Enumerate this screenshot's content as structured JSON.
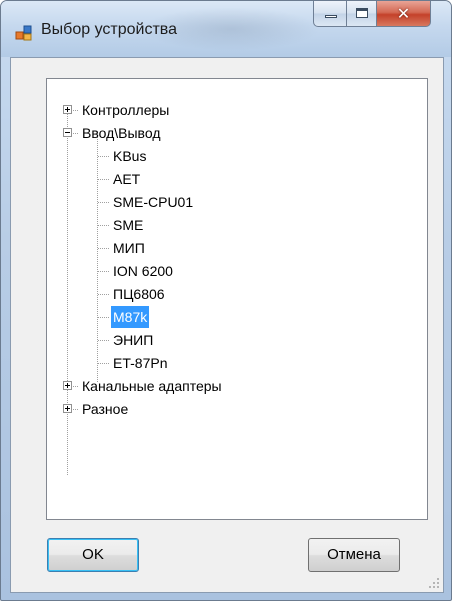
{
  "window": {
    "title": "Выбор устройства"
  },
  "tree": {
    "nodes": [
      {
        "label": "Контроллеры",
        "expanded": false
      },
      {
        "label": "Ввод\\Вывод",
        "expanded": true,
        "children": [
          "KBus",
          "AET",
          "SME-CPU01",
          "SME",
          "МИП",
          "ION 6200",
          "ПЦ6806",
          "M87k",
          "ЭНИП",
          "ET-87Pn"
        ],
        "selected_child": "M87k"
      },
      {
        "label": "Канальные адаптеры",
        "expanded": false
      },
      {
        "label": "Разное",
        "expanded": false
      }
    ]
  },
  "buttons": {
    "ok": "OK",
    "cancel": "Отмена"
  },
  "colors": {
    "selection": "#3399ff",
    "close_button": "#c4412a"
  }
}
